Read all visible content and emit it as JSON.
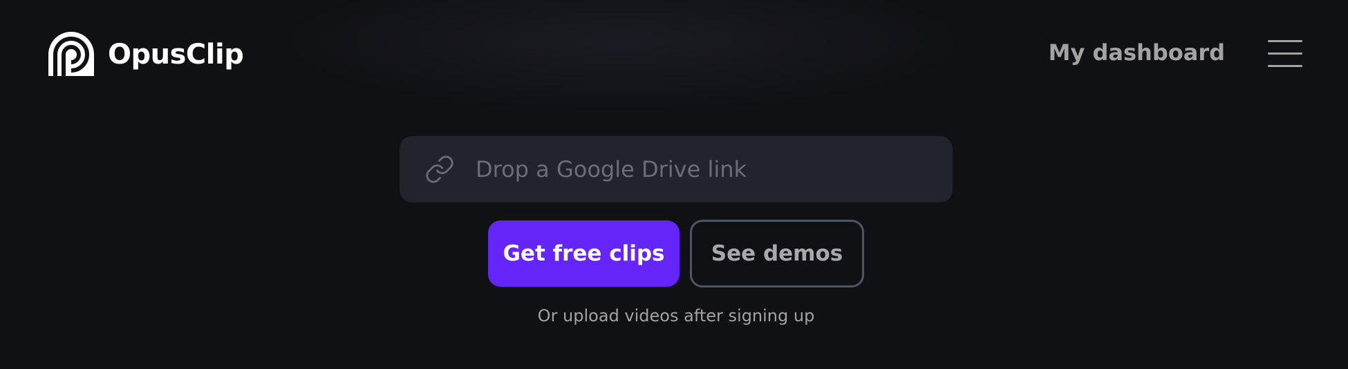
{
  "header": {
    "logo_icon": "opusclip-logo-icon",
    "brand_name": "OpusClip",
    "dashboard_link": "My dashboard",
    "menu_icon": "hamburger-menu-icon"
  },
  "hero": {
    "link_icon": "link-icon",
    "url_input_value": "",
    "url_input_placeholder": "Drop a Google Drive link",
    "primary_button": "Get free clips",
    "secondary_button": "See demos",
    "upload_hint": "Or upload videos after signing up"
  },
  "colors": {
    "background": "#101115",
    "input_background": "#21232d",
    "primary_accent": "#6625f8",
    "secondary_border": "#4f5466",
    "muted_text": "#a3a3a3"
  }
}
